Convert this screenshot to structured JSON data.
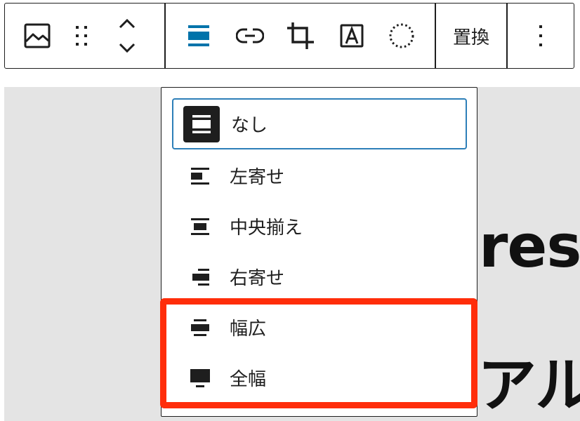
{
  "toolbar": {
    "buttons": [
      {
        "name": "image-block-icon"
      },
      {
        "name": "drag-handle-icon"
      },
      {
        "name": "move-up-down-icon"
      },
      {
        "name": "align-none-icon"
      },
      {
        "name": "link-icon"
      },
      {
        "name": "crop-icon"
      },
      {
        "name": "text-overlay-icon"
      },
      {
        "name": "duotone-icon"
      }
    ],
    "replace_label": "置換",
    "more_icon": "more-vertical-icon",
    "accent_color": "#0073aa"
  },
  "canvas": {
    "heading_line1": "res",
    "heading_line2": "アル"
  },
  "align_menu": {
    "items": [
      {
        "label": "なし",
        "icon": "align-none-icon",
        "selected": true
      },
      {
        "label": "左寄せ",
        "icon": "align-left-icon"
      },
      {
        "label": "中央揃え",
        "icon": "align-center-icon"
      },
      {
        "label": "右寄せ",
        "icon": "align-right-icon"
      },
      {
        "label": "幅広",
        "icon": "align-wide-icon"
      },
      {
        "label": "全幅",
        "icon": "align-full-width-icon"
      }
    ],
    "selected_border_color": "#2d7fb8",
    "highlight_color": "#ff2d0a"
  }
}
